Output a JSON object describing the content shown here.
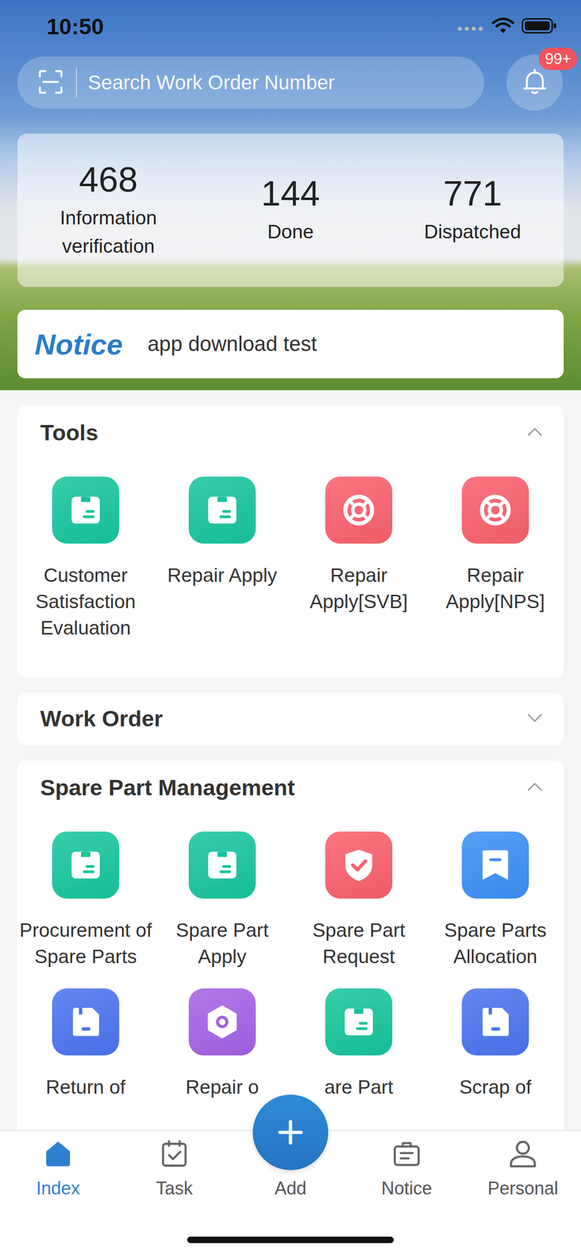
{
  "status_bar": {
    "time": "10:50"
  },
  "search": {
    "placeholder": "Search Work Order Number"
  },
  "notifications": {
    "badge": "99+"
  },
  "stats": [
    {
      "value": "468",
      "label": "Information verification"
    },
    {
      "value": "144",
      "label": "Done"
    },
    {
      "value": "771",
      "label": "Dispatched"
    }
  ],
  "notice": {
    "title": "Notice",
    "text": "app download test"
  },
  "sections": [
    {
      "title": "Tools",
      "expanded": true,
      "items": [
        {
          "label": "Customer Satisfaction Evaluation",
          "kind": "box",
          "color": "#16c49c"
        },
        {
          "label": "Repair Apply",
          "kind": "box",
          "color": "#16c49c"
        },
        {
          "label": "Repair Apply[SVB]",
          "kind": "lifebuoy",
          "color": "#f85f6c"
        },
        {
          "label": "Repair Apply[NPS]",
          "kind": "lifebuoy",
          "color": "#f85f6c"
        }
      ]
    },
    {
      "title": "Work Order",
      "expanded": false,
      "items": []
    },
    {
      "title": "Spare Part Management",
      "expanded": true,
      "items": [
        {
          "label": "Procurement of Spare Parts",
          "kind": "box",
          "color": "#16c49c"
        },
        {
          "label": "Spare Part Apply",
          "kind": "box",
          "color": "#16c49c"
        },
        {
          "label": "Spare Part Request",
          "kind": "shield",
          "color": "#f85f6c"
        },
        {
          "label": "Spare Parts Allocation",
          "kind": "bookmark",
          "color": "#3b8ff5"
        },
        {
          "label": "Return of",
          "kind": "floppy",
          "color": "#4a73ee"
        },
        {
          "label": "Repair o",
          "kind": "hex",
          "color": "#a462e4"
        },
        {
          "label": "are Part",
          "kind": "box",
          "color": "#16c49c"
        },
        {
          "label": "Scrap of",
          "kind": "floppy",
          "color": "#4a73ee"
        }
      ]
    }
  ],
  "tabs": [
    {
      "label": "Index",
      "kind": "home",
      "selected": true
    },
    {
      "label": "Task",
      "kind": "task",
      "selected": false
    },
    {
      "label": "Add",
      "kind": "add",
      "selected": false
    },
    {
      "label": "Notice",
      "kind": "notice",
      "selected": false
    },
    {
      "label": "Personal",
      "kind": "personal",
      "selected": false
    }
  ]
}
